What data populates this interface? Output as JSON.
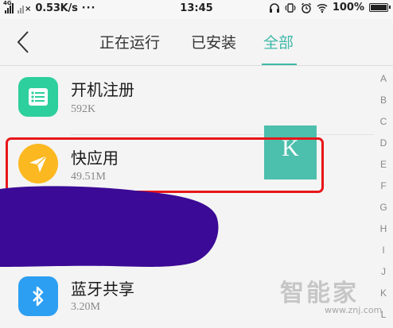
{
  "status_bar": {
    "signal_tag": "4G",
    "net_speed": "0.53K/s",
    "more": "···",
    "time": "13:45",
    "battery_percent": "100%",
    "battery_level": 1.0,
    "icons": [
      "signal-icon",
      "no-signal-icon",
      "headset-icon",
      "alarm-icon",
      "wifi-icon",
      "battery-icon"
    ]
  },
  "nav": {
    "back_icon": "chevron-left-icon",
    "tabs": [
      {
        "label": "正在运行"
      },
      {
        "label": "已安装"
      },
      {
        "label": "全部",
        "active": true
      }
    ],
    "accent_color": "#3fb9a8"
  },
  "apps": [
    {
      "name": "开机注册",
      "size": "592K",
      "icon": "list-icon",
      "icon_color": "#2dcf9c"
    },
    {
      "name": "快应用",
      "size": "49.51M",
      "icon": "paper-plane-icon",
      "icon_color": "#fbb820"
    },
    {
      "name": "蓝牙共享",
      "size": "3.20M",
      "icon": "bluetooth-icon",
      "icon_color": "#2d9ff2"
    }
  ],
  "index_bar": [
    "A",
    "B",
    "C",
    "D",
    "E",
    "F",
    "G",
    "H",
    "I",
    "J",
    "K",
    "L"
  ],
  "letter_popup": "K",
  "annotation": {
    "highlight_color": "#e8161a",
    "redaction_color": "#3b0a96"
  },
  "watermark": {
    "text": "智能家",
    "url": "www.znj.com"
  }
}
